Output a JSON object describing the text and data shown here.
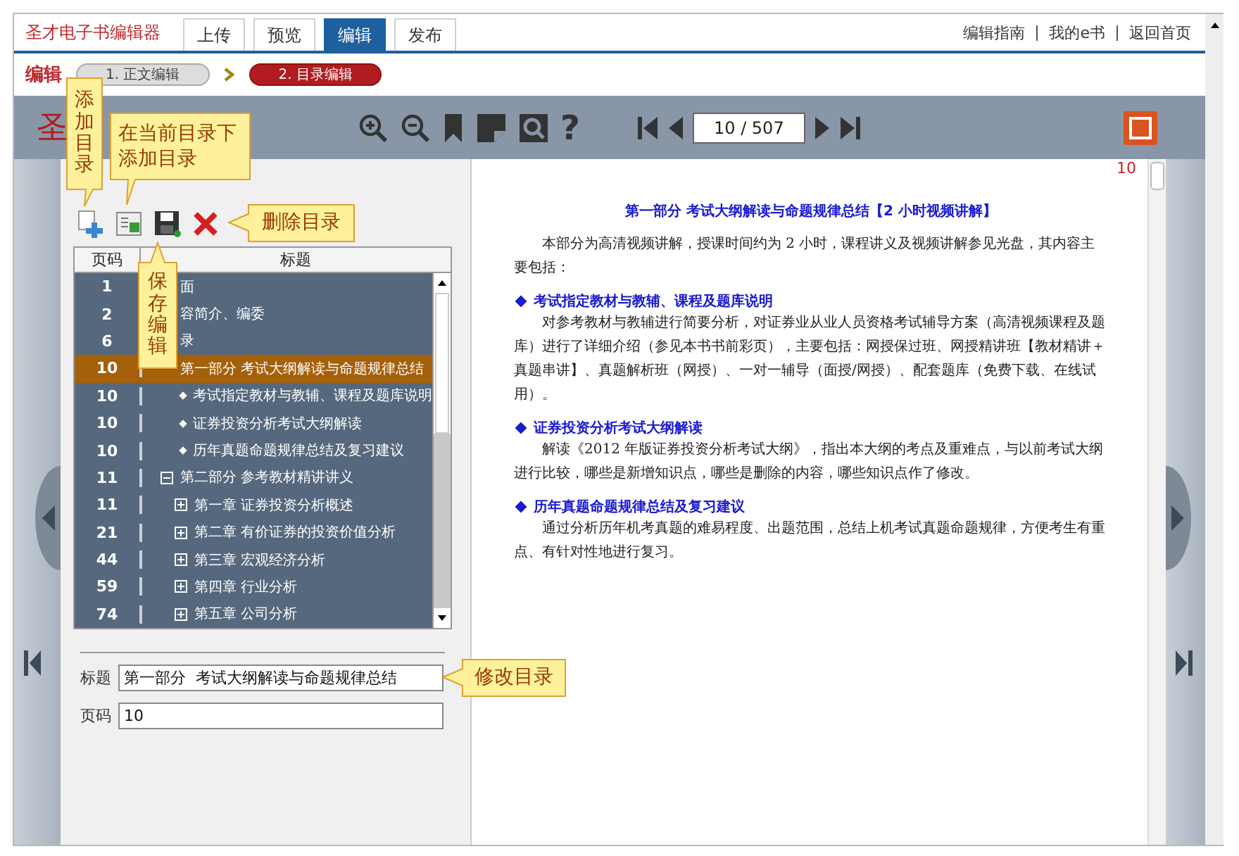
{
  "app": {
    "title": "圣才电子书编辑器"
  },
  "tabs": [
    {
      "label": "上传",
      "selected": false
    },
    {
      "label": "预览",
      "selected": false
    },
    {
      "label": "编辑",
      "selected": true
    },
    {
      "label": "发布",
      "selected": false
    }
  ],
  "links": [
    "编辑指南",
    "我的e书",
    "返回首页"
  ],
  "breadcrumb": {
    "label": "编辑",
    "steps": [
      {
        "label": "1. 正文编辑",
        "selected": false
      },
      {
        "label": "2. 目录编辑",
        "selected": true
      }
    ]
  },
  "viewer": {
    "logo": "圣",
    "help": "?",
    "page_field": "10 / 507",
    "page_number": "10"
  },
  "toc": {
    "columns": [
      "页码",
      "标题"
    ],
    "rows": [
      {
        "page": "1",
        "title": "面",
        "selected": false
      },
      {
        "page": "2",
        "title": "容简介、编委",
        "selected": false
      },
      {
        "page": "6",
        "title": "录",
        "selected": false
      },
      {
        "page": "10",
        "title": "第一部分  考试大纲解读与命题规律总结",
        "selected": true,
        "children": [
          {
            "page": "10",
            "title": "考试指定教材与教辅、课程及题库说明",
            "selected": false
          },
          {
            "page": "10",
            "title": "证券投资分析考试大纲解读",
            "selected": false
          },
          {
            "page": "10",
            "title": "历年真题命题规律总结及复习建议",
            "selected": false
          }
        ]
      },
      {
        "page": "11",
        "title": "第二部分  参考教材精讲讲义",
        "selected": false,
        "expanded": true,
        "children": [
          {
            "page": "11",
            "title": "第一章   证券投资分析概述",
            "selected": false,
            "expanded": false
          },
          {
            "page": "21",
            "title": "第二章   有价证券的投资价值分析",
            "selected": false,
            "expanded": false
          },
          {
            "page": "44",
            "title": "第三章   宏观经济分析",
            "selected": false,
            "expanded": false
          },
          {
            "page": "59",
            "title": "第四章   行业分析",
            "selected": false,
            "expanded": false
          },
          {
            "page": "74",
            "title": "第五章   公司分析",
            "selected": false,
            "expanded": false
          }
        ]
      }
    ]
  },
  "form": [
    {
      "label": "标题",
      "value": "第一部分  考试大纲解读与命题规律总结"
    },
    {
      "label": "页码",
      "value": "10"
    }
  ],
  "page": {
    "heading": "第一部分   考试大纲解读与命题规律总结【2 小时视频讲解】",
    "intro": "本部分为高清视频讲解，授课时间约为 2 小时，课程讲义及视频讲解参见光盘，其内容主要包括：",
    "sections": [
      {
        "title": "考试指定教材与教辅、课程及题库说明",
        "body": "对参考教材与教辅进行简要分析，对证券业从业人员资格考试辅导方案（高清视频课程及题库）进行了详细介绍（参见本书书前彩页），主要包括：网授保过班、网授精讲班【教材精讲＋真题串讲】、真题解析班（网授）、一对一辅导（面授/网授）、配套题库（免费下载、在线试用）。"
      },
      {
        "title": "证券投资分析考试大纲解读",
        "body": "解读《2012 年版证券投资分析考试大纲》，指出本大纲的考点及重难点，与以前考试大纲进行比较，哪些是新增知识点，哪些是删除的内容，哪些知识点作了修改。"
      },
      {
        "title": "历年真题命题规律总结及复习建议",
        "body": "通过分析历年机考真题的难易程度、出题范围，总结上机考试真题命题规律，方便考生有重点、有针对性地进行复习。"
      }
    ]
  },
  "callouts": [
    {
      "text": "添加目录",
      "kind": "vertical"
    },
    {
      "text": "在当前目录下添加目录",
      "kind": "horizontal"
    },
    {
      "text": "删除目录",
      "kind": "horizontal"
    },
    {
      "text": "保存编辑",
      "kind": "vertical"
    },
    {
      "text": "修改目录",
      "kind": "horizontal"
    }
  ]
}
